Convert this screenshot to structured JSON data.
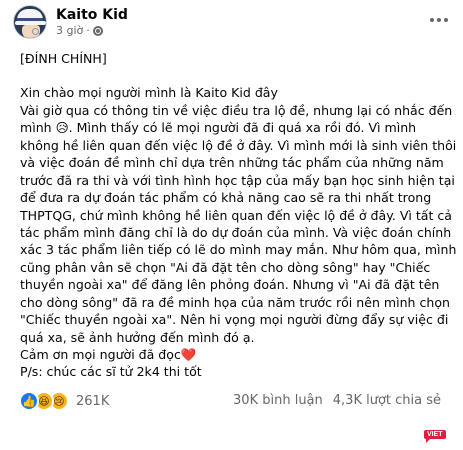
{
  "post": {
    "author": "Kaito Kid",
    "time": "3 giờ",
    "time_separator": "·",
    "body_lines": [
      "[ĐÍNH CHÍNH]",
      "",
      "Xin chào mọi người mình là Kaito Kid đây",
      "Vài giờ qua có thông tin về việc điều tra lộ đề, nhưng lại có nhắc đến",
      "mình 😥. Mình thấy có lẽ mọi người đã đi quá xa rồi đó. Vì mình",
      "không hề liên quan đến việc lộ đề ở đây. Vì mình mới là sinh viên thôi",
      "và việc đoán đề mình chỉ dựa trên những tác phẩm của những năm",
      "trước đã ra thi và với tình hình học tập của mấy bạn học sinh hiện tại",
      "để đưa ra dự đoán tác phẩm có khả năng cao sẽ ra thi nhất trong",
      "THPTQG, chứ mình không hề liên quan đến việc lộ đề ở đây. Vì tất cả",
      "tác phẩm mình đăng chỉ là do dự đoán của mình. Và việc đoán chính",
      "xác 3 tác phẩm liên tiếp có lẽ do mình may mắn. Như hôm qua, mình",
      "cũng phân vân sẽ chọn \"Ai đã đặt tên cho dòng sông\" hay \"Chiếc",
      "thuyền ngoài xa\" để đăng lên phỏng đoán. Nhưng vì \"Ai đã đặt tên",
      "cho dòng sông\" đã ra đề minh họa của năm trước rồi nên mình chọn",
      "\"Chiếc thuyền ngoài xa\". Nên hi vọng mọi người đừng đẩy sự việc đi",
      "quá xa, sẽ ảnh hưởng đến mình đó ạ.",
      "Cảm ơn mọi người đã đọc❤️",
      "P/s: chúc các sĩ tử 2k4 thi tốt"
    ]
  },
  "reactions": {
    "count": "261K",
    "icons": [
      "like-icon",
      "haha-icon",
      "sad-icon"
    ]
  },
  "stats": {
    "comments": "30K bình luận",
    "shares": "4,3K lượt chia sẻ"
  },
  "watermark": "VIET",
  "colors": {
    "like": "#1877f2",
    "emoji": "#f7b125",
    "heart": "#e41e3f",
    "muted": "#65676b"
  }
}
